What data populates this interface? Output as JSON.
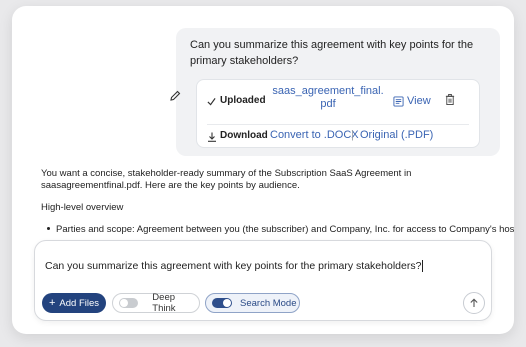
{
  "user_message": {
    "text": "Can you summarize this agreement with key points for the primary stakeholders?",
    "edit_icon": "pencil-icon"
  },
  "attachment": {
    "status_label": "Uploaded",
    "status_icon": "check-icon",
    "filename": "saas_agreement_final.pdf",
    "view_label": "View",
    "view_icon": "document-view-icon",
    "delete_icon": "trash-icon",
    "download_label": "Download",
    "download_icon": "download-icon",
    "convert_docx_label": "Convert to .DOCX",
    "separator": "|",
    "original_pdf_label": "Original (.PDF)"
  },
  "assistant": {
    "para1": "You want a concise, stakeholder-ready summary of the Subscription SaaS Agreement in saasagreementfinal.pdf. Here are the key points by audience.",
    "para2": "High-level overview",
    "bullet1": "Parties and scope: Agreement between you (the subscriber) and Company, Inc. for access to Company's hosted"
  },
  "composer": {
    "input_value": "Can you summarize this agreement with key points for the primary stakeholders?",
    "add_files_label": "Add Files",
    "deep_think_label": "Deep Think",
    "deep_think_on": false,
    "search_mode_label": "Search Mode",
    "search_mode_on": true,
    "send_icon": "arrow-up-icon"
  },
  "colors": {
    "accent": "#23437e",
    "link": "#3a64b3",
    "bubble": "#f1f2f4"
  }
}
